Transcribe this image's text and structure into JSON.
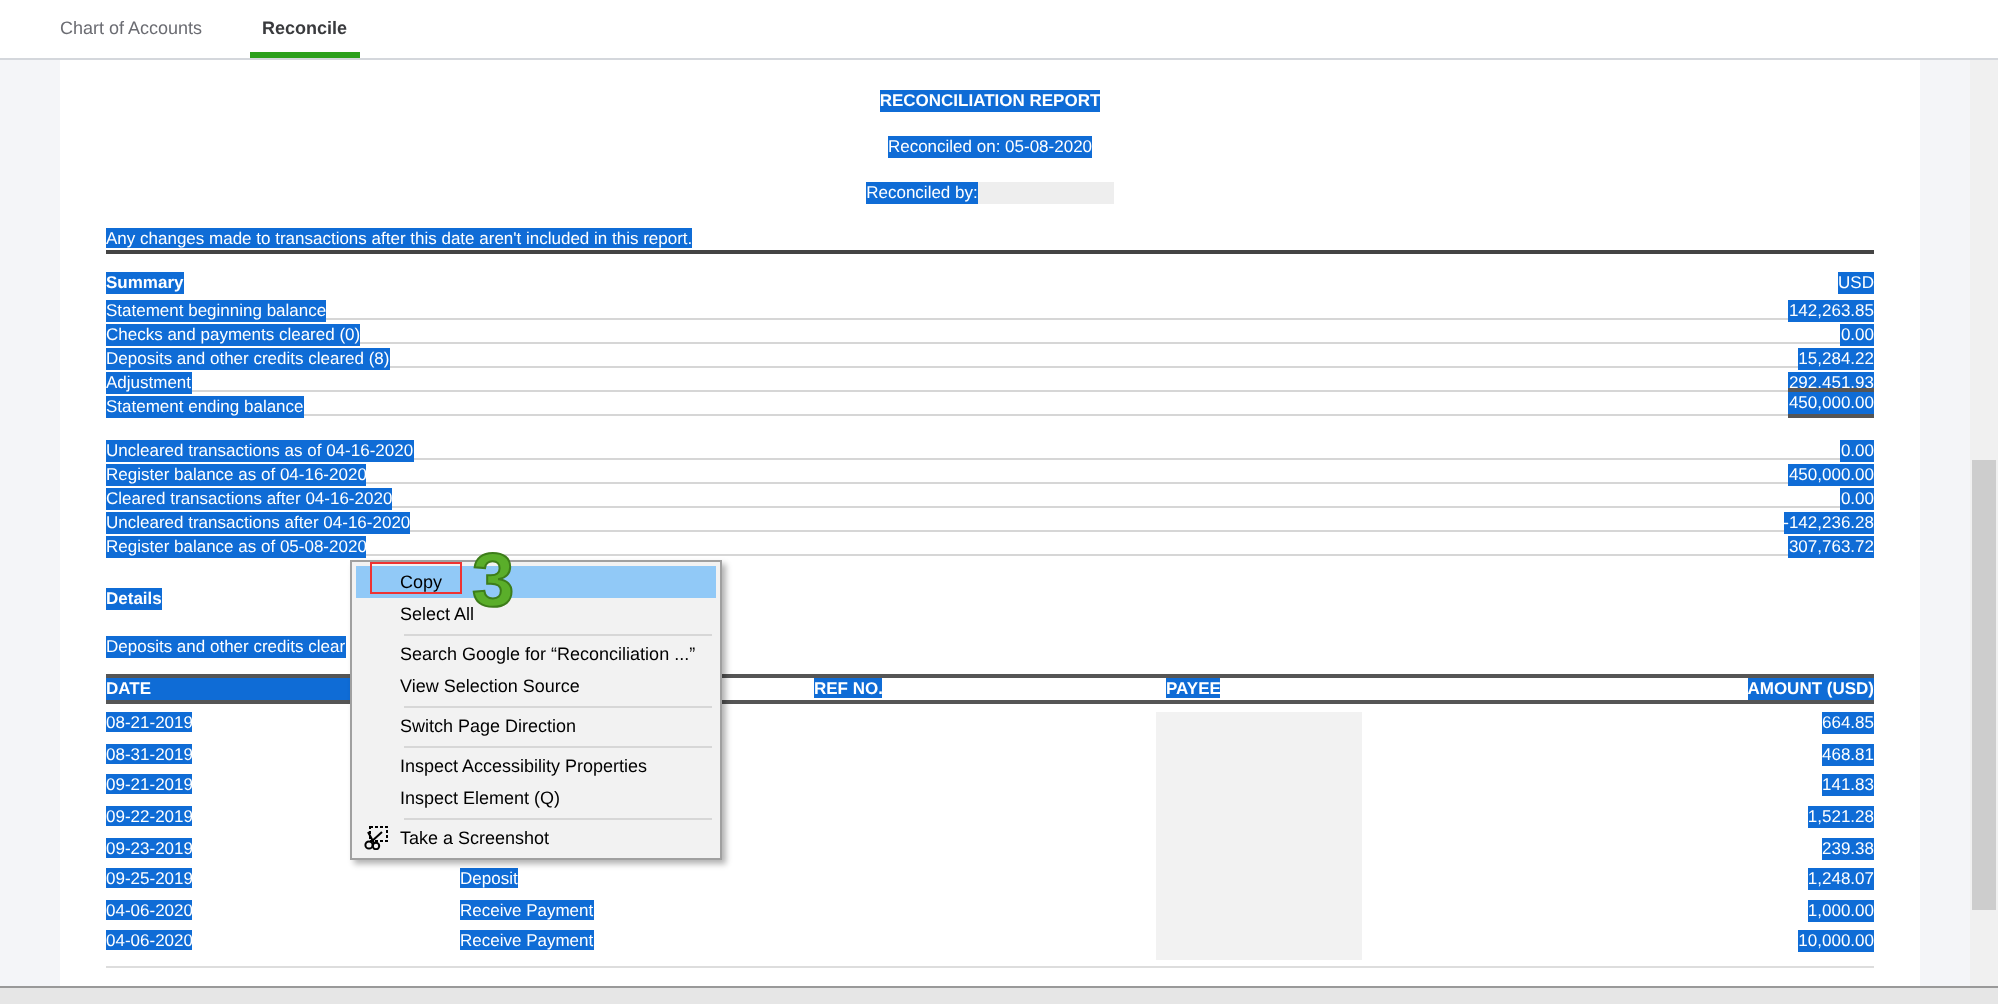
{
  "tabs": [
    {
      "label": "Chart of Accounts",
      "selected": false
    },
    {
      "label": "Reconcile",
      "selected": true
    }
  ],
  "report": {
    "selected": true,
    "title": "RECONCILIATION REPORT",
    "reconciled_on": "Reconciled on: 05-08-2020",
    "reconciled_by": "Reconciled by:",
    "disclaimer": "Any changes made to transactions after this date aren't included in this report.",
    "summary_heading": "Summary",
    "currency": "USD",
    "summary_rows": [
      {
        "label": "Statement beginning balance",
        "amount": "142,263.85",
        "kind": "line"
      },
      {
        "label": "Checks and payments cleared (0)",
        "amount": "0.00",
        "kind": "line"
      },
      {
        "label": "Deposits and other credits cleared (8)",
        "amount": "15,284.22",
        "kind": "line"
      },
      {
        "label": "Adjustment",
        "amount": "292,451.93",
        "kind": "line"
      },
      {
        "label": "Statement ending balance",
        "amount": "450,000.00",
        "kind": "total"
      }
    ],
    "register_rows": [
      {
        "label": "Uncleared transactions as of 04-16-2020",
        "amount": "0.00",
        "kind": "line"
      },
      {
        "label": "Register balance as of 04-16-2020",
        "amount": "450,000.00",
        "kind": "line"
      },
      {
        "label": "Cleared transactions after 04-16-2020",
        "amount": "0.00",
        "kind": "line"
      },
      {
        "label": "Uncleared transactions after 04-16-2020",
        "amount": "-142,236.28",
        "kind": "line"
      },
      {
        "label": "Register balance as of 05-08-2020",
        "amount": "307,763.72",
        "kind": "line"
      }
    ],
    "details_heading": "Details",
    "section_heading": "Deposits and other credits clear",
    "columns": {
      "date": "DATE",
      "ref_no": "REF NO.",
      "payee": "PAYEE",
      "amount": "AMOUNT (USD)"
    },
    "rows": [
      {
        "date": "08-21-2019",
        "amount": "664.85"
      },
      {
        "date": "08-31-2019",
        "amount": "468.81"
      },
      {
        "date": "09-21-2019",
        "amount": "141.83"
      },
      {
        "date": "09-22-2019",
        "amount": "1,521.28"
      },
      {
        "date": "09-23-2019",
        "amount": "239.38"
      },
      {
        "date": "09-25-2019",
        "type": "Deposit",
        "amount": "1,248.07"
      },
      {
        "date": "04-06-2020",
        "type": "Receive Payment",
        "amount": "1,000.00"
      },
      {
        "date": "04-06-2020",
        "type": "Receive Payment",
        "amount": "10,000.00"
      }
    ]
  },
  "context_menu": {
    "groups": [
      [
        {
          "label": "Copy",
          "kind": "plain",
          "selected": true
        },
        {
          "label": "Select All",
          "kind": "plain",
          "selected": false
        }
      ],
      [
        {
          "label": "Search Google for “Reconciliation ...”",
          "kind": "plain",
          "selected": false
        },
        {
          "label": "View Selection Source",
          "kind": "plain",
          "selected": false
        }
      ],
      [
        {
          "label": "Switch Page Direction",
          "kind": "plain",
          "selected": false
        }
      ],
      [
        {
          "label": "Inspect Accessibility Properties",
          "kind": "plain",
          "selected": false
        },
        {
          "label": "Inspect Element (Q)",
          "kind": "plain",
          "selected": false
        }
      ],
      [
        {
          "label": "Take a Screenshot",
          "kind": "icon",
          "selected": false
        }
      ]
    ]
  },
  "annotation": {
    "step": "3"
  }
}
